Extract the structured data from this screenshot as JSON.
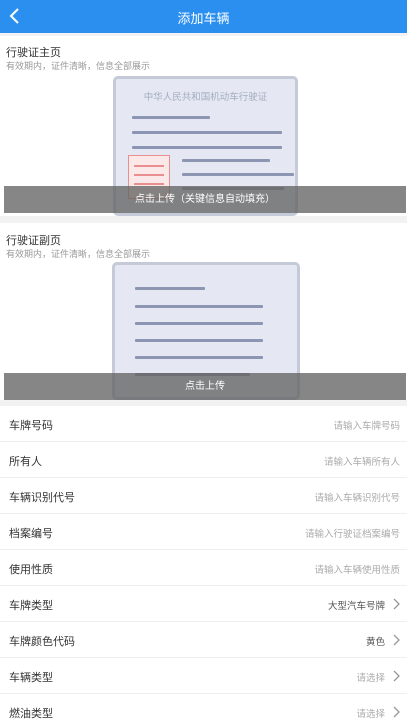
{
  "header": {
    "title": "添加车辆",
    "back_icon": "chevron-left-icon"
  },
  "front_section": {
    "title": "行驶证主页",
    "subtitle": "有效期内，证件清晰，信息全部展示",
    "card_caption": "中华人民共和国机动车行驶证",
    "upload_label": "点击上传（关键信息自动填充）"
  },
  "back_section": {
    "title": "行驶证副页",
    "subtitle": "有效期内，证件清晰，信息全部展示",
    "upload_label": "点击上传"
  },
  "form": {
    "rows": [
      {
        "label": "车牌号码",
        "value": "请输入车牌号码",
        "kind": "input"
      },
      {
        "label": "所有人",
        "value": "请输入车辆所有人",
        "kind": "input"
      },
      {
        "label": "车辆识别代号",
        "value": "请输入车辆识别代号",
        "kind": "input"
      },
      {
        "label": "档案编号",
        "value": "请输入行驶证档案编号",
        "kind": "input"
      },
      {
        "label": "使用性质",
        "value": "请输入车辆使用性质",
        "kind": "input"
      },
      {
        "label": "车牌类型",
        "value": "大型汽车号牌",
        "kind": "select"
      },
      {
        "label": "车牌颜色代码",
        "value": "黄色",
        "kind": "select"
      },
      {
        "label": "车辆类型",
        "value": "请选择",
        "kind": "select"
      },
      {
        "label": "燃油类型",
        "value": "请选择",
        "kind": "select"
      }
    ]
  },
  "colors": {
    "primary": "#2b8ff0"
  }
}
